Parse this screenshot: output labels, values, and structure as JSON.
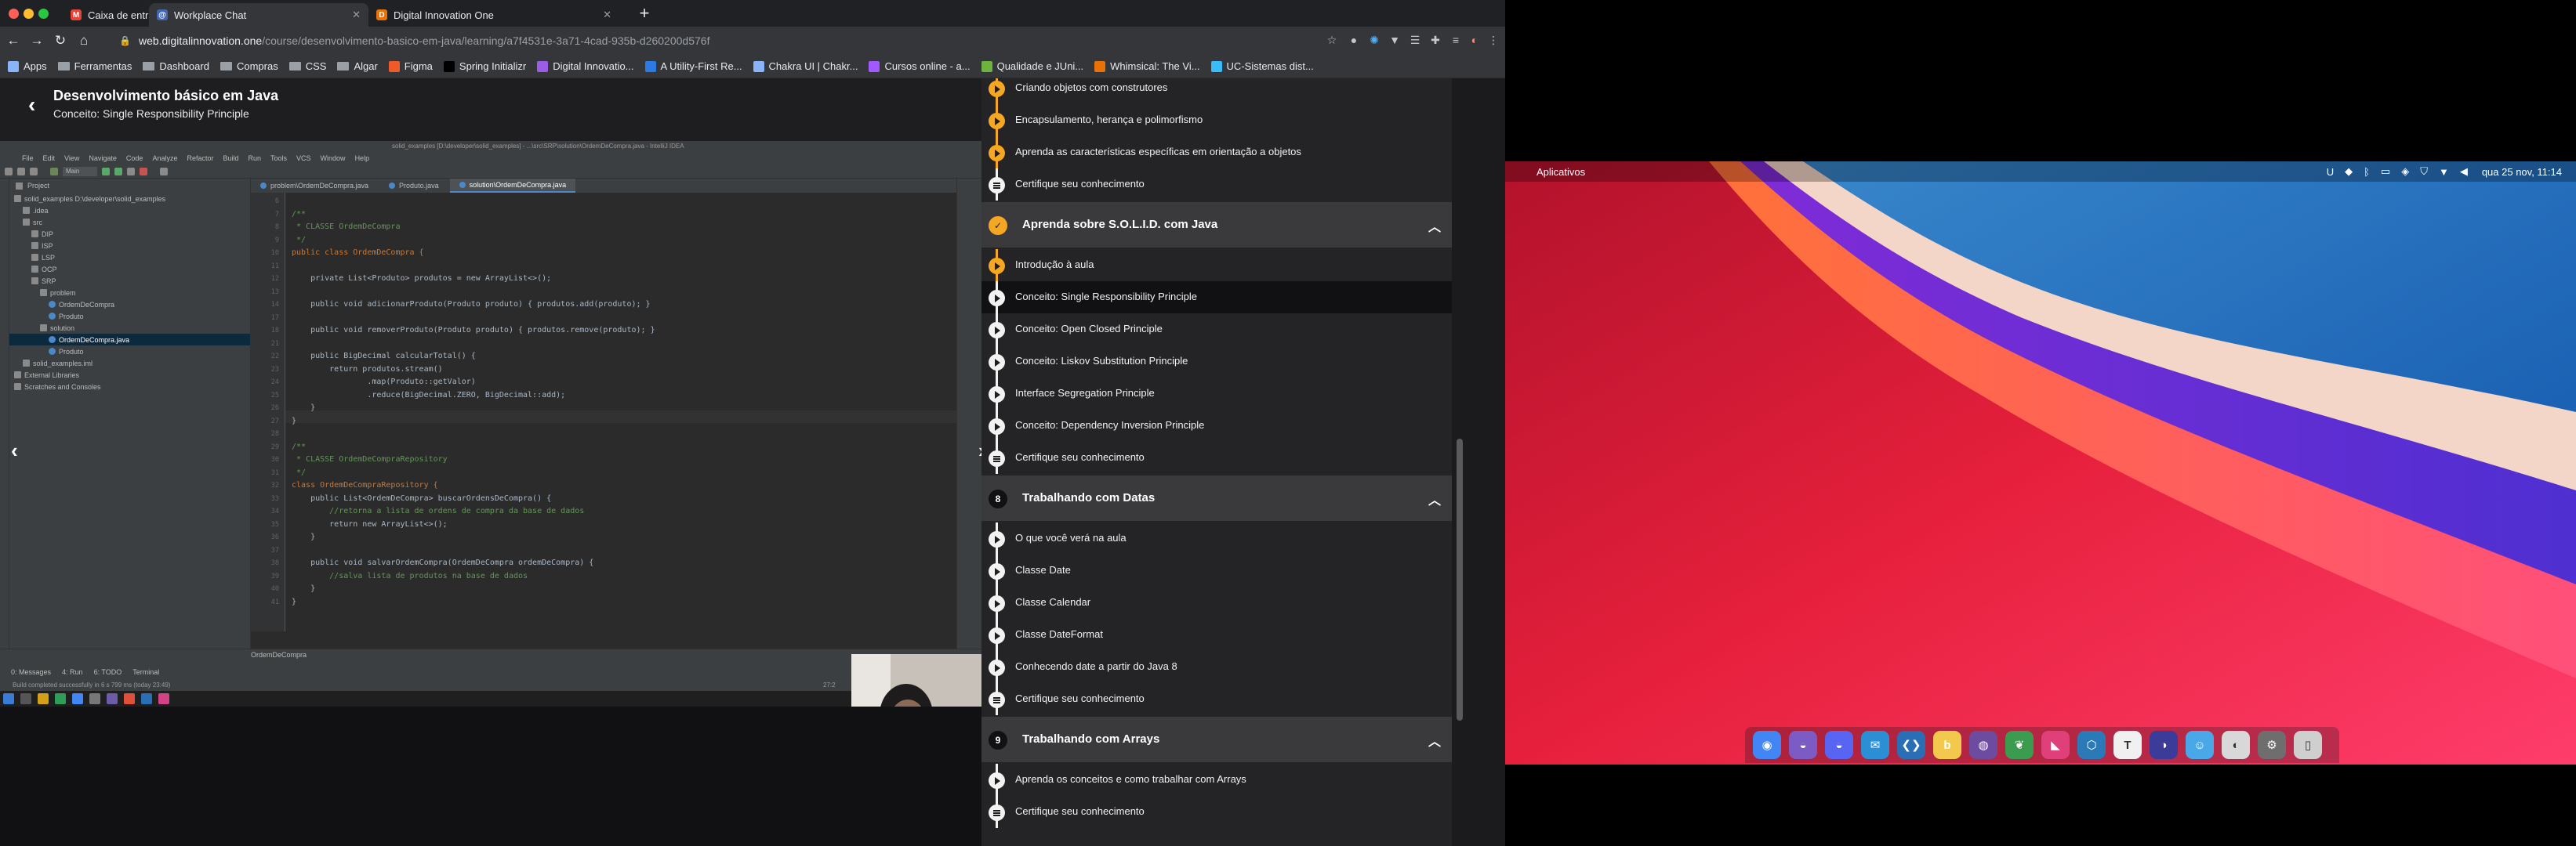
{
  "browser": {
    "tabs": [
      {
        "title": "Caixa de entrada - marcosvo",
        "active": false,
        "icon": "gmail-icon",
        "color": "#ea4335"
      },
      {
        "title": "Workplace Chat",
        "active": true,
        "icon": "workplace-chat-icon",
        "color": "#4267b2"
      },
      {
        "title": "Digital Innovation One",
        "active": false,
        "icon": "dio-icon",
        "color": "#e8710a"
      }
    ],
    "address": {
      "host": "web.digitalinnovation.one",
      "path": "/course/desenvolvimento-basico-em-java/learning/a7f4531e-3a71-4cad-935b-d260200d576f"
    },
    "bookmarks": [
      {
        "label": "Apps",
        "type": "apps-icon"
      },
      {
        "label": "Ferramentas",
        "type": "folder"
      },
      {
        "label": "Dashboard",
        "type": "folder"
      },
      {
        "label": "Compras",
        "type": "folder"
      },
      {
        "label": "CSS",
        "type": "folder"
      },
      {
        "label": "Algar",
        "type": "folder"
      },
      {
        "label": "Figma",
        "type": "figma-icon"
      },
      {
        "label": "Spring Initializr",
        "type": "spring-icon"
      },
      {
        "label": "Digital Innovatio...",
        "type": "dio-icon"
      },
      {
        "label": "A Utility-First Re...",
        "type": "tailwind-icon"
      },
      {
        "label": "Chakra UI | Chakr...",
        "type": "chakra-icon"
      },
      {
        "label": "Cursos online - a...",
        "type": "alura-icon"
      },
      {
        "label": "Qualidade e JUni...",
        "type": "medium-icon"
      },
      {
        "label": "Whimsical: The Vi...",
        "type": "whimsical-icon"
      },
      {
        "label": "UC-Sistemas dist...",
        "type": "uc-icon"
      }
    ]
  },
  "course": {
    "title": "Desenvolvimento básico em Java",
    "subtitle": "Conceito: Single Responsibility Principle"
  },
  "ide": {
    "title": "solid_examples [D:\\developer\\solid_examples] - ...\\src\\SRP\\solution\\OrdemDeCompra.java - IntelliJ IDEA",
    "menu": [
      "File",
      "Edit",
      "View",
      "Navigate",
      "Code",
      "Analyze",
      "Refactor",
      "Build",
      "Run",
      "Tools",
      "VCS",
      "Window",
      "Help"
    ],
    "run_config": "Main",
    "project_header": "Project",
    "tree": [
      {
        "label": "solid_examples D:\\developer\\solid_examples",
        "indent": 0,
        "type": "module",
        "selected": false
      },
      {
        "label": ".idea",
        "indent": 1,
        "type": "folder",
        "selected": false
      },
      {
        "label": "src",
        "indent": 1,
        "type": "folder",
        "selected": false
      },
      {
        "label": "DIP",
        "indent": 2,
        "type": "package",
        "selected": false
      },
      {
        "label": "ISP",
        "indent": 2,
        "type": "package",
        "selected": false
      },
      {
        "label": "LSP",
        "indent": 2,
        "type": "package",
        "selected": false
      },
      {
        "label": "OCP",
        "indent": 2,
        "type": "package",
        "selected": false
      },
      {
        "label": "SRP",
        "indent": 2,
        "type": "package",
        "selected": false
      },
      {
        "label": "problem",
        "indent": 3,
        "type": "package",
        "selected": false
      },
      {
        "label": "OrdemDeCompra",
        "indent": 4,
        "type": "class",
        "selected": false
      },
      {
        "label": "Produto",
        "indent": 4,
        "type": "class",
        "selected": false
      },
      {
        "label": "solution",
        "indent": 3,
        "type": "package",
        "selected": false
      },
      {
        "label": "OrdemDeCompra.java",
        "indent": 4,
        "type": "class",
        "selected": true
      },
      {
        "label": "Produto",
        "indent": 4,
        "type": "class",
        "selected": false
      },
      {
        "label": "solid_examples.iml",
        "indent": 1,
        "type": "file",
        "selected": false
      },
      {
        "label": "External Libraries",
        "indent": 0,
        "type": "library",
        "selected": false
      },
      {
        "label": "Scratches and Consoles",
        "indent": 0,
        "type": "scratch",
        "selected": false
      }
    ],
    "editor_tabs": [
      {
        "label": "problem\\OrdemDeCompra.java",
        "active": false
      },
      {
        "label": "Produto.java",
        "active": false
      },
      {
        "label": "solution\\OrdemDeCompra.java",
        "active": true
      }
    ],
    "code_lines": [
      {
        "n": "6",
        "text": ""
      },
      {
        "n": "7",
        "text": "/**",
        "cls": "cm"
      },
      {
        "n": "8",
        "text": " * CLASSE OrdemDeCompra",
        "cls": "cm"
      },
      {
        "n": "9",
        "text": " */",
        "cls": "cm"
      },
      {
        "n": "10",
        "text": "public class OrdemDeCompra {",
        "cls": "kw"
      },
      {
        "n": "11",
        "text": ""
      },
      {
        "n": "12",
        "text": "    private List<Produto> produtos = new ArrayList<>();"
      },
      {
        "n": "13",
        "text": ""
      },
      {
        "n": "14",
        "text": "    public void adicionarProduto(Produto produto) { produtos.add(produto); }"
      },
      {
        "n": "17",
        "text": ""
      },
      {
        "n": "18",
        "text": "    public void removerProduto(Produto produto) { produtos.remove(produto); }"
      },
      {
        "n": "21",
        "text": ""
      },
      {
        "n": "22",
        "text": "    public BigDecimal calcularTotal() {"
      },
      {
        "n": "23",
        "text": "        return produtos.stream()"
      },
      {
        "n": "24",
        "text": "                .map(Produto::getValor)"
      },
      {
        "n": "25",
        "text": "                .reduce(BigDecimal.ZERO, BigDecimal::add);"
      },
      {
        "n": "26",
        "text": "    }"
      },
      {
        "n": "27",
        "text": "}"
      },
      {
        "n": "28",
        "text": ""
      },
      {
        "n": "29",
        "text": "/**",
        "cls": "cm"
      },
      {
        "n": "30",
        "text": " * CLASSE OrdemDeCompraRepository",
        "cls": "cm"
      },
      {
        "n": "31",
        "text": " */",
        "cls": "cm"
      },
      {
        "n": "32",
        "text": "class OrdemDeCompraRepository {",
        "cls": "kw"
      },
      {
        "n": "33",
        "text": "    public List<OrdemDeCompra> buscarOrdensDeCompra() {"
      },
      {
        "n": "34",
        "text": "        //retorna a lista de ordens de compra da base de dados",
        "cls": "cm"
      },
      {
        "n": "35",
        "text": "        return new ArrayList<>();"
      },
      {
        "n": "36",
        "text": "    }"
      },
      {
        "n": "37",
        "text": ""
      },
      {
        "n": "38",
        "text": "    public void salvarOrdemCompra(OrdemDeCompra ordemDeCompra) {"
      },
      {
        "n": "39",
        "text": "        //salva lista de produtos na base de dados",
        "cls": "cm"
      },
      {
        "n": "40",
        "text": "    }"
      },
      {
        "n": "41",
        "text": "}"
      }
    ],
    "breadcrumb": "OrdemDeCompra",
    "bottom_tabs": [
      "0: Messages",
      "4: Run",
      "6: TODO",
      "Terminal"
    ],
    "status": "Build completed successfully in 6 s 799 ms (today 23:49)",
    "cursor_pos": "27:2"
  },
  "sidebar": {
    "items_top": [
      {
        "label": "Criando objetos com construtores",
        "icon": "play",
        "color": "orange"
      },
      {
        "label": "Encapsulamento, herança e polimorfismo",
        "icon": "play",
        "color": "orange"
      },
      {
        "label": "Aprenda as características específicas em orientação a objetos",
        "icon": "play",
        "color": "orange"
      },
      {
        "label": "Certifique seu conhecimento",
        "icon": "quiz",
        "color": "white"
      }
    ],
    "sections": [
      {
        "number": "✓",
        "title": "Aprenda sobre S.O.L.I.D. com Java",
        "done": true,
        "items": [
          {
            "label": "Introdução à aula",
            "icon": "play",
            "color": "orange",
            "current": false
          },
          {
            "label": "Conceito: Single Responsibility Principle",
            "icon": "play",
            "color": "white",
            "current": true
          },
          {
            "label": "Conceito: Open Closed Principle",
            "icon": "play",
            "color": "white",
            "current": false
          },
          {
            "label": "Conceito: Liskov Substitution Principle",
            "icon": "play",
            "color": "white",
            "current": false
          },
          {
            "label": "Interface Segregation Principle",
            "icon": "play",
            "color": "white",
            "current": false
          },
          {
            "label": "Conceito: Dependency Inversion Principle",
            "icon": "play",
            "color": "white",
            "current": false
          },
          {
            "label": "Certifique seu conhecimento",
            "icon": "quiz",
            "color": "white",
            "current": false
          }
        ]
      },
      {
        "number": "8",
        "title": "Trabalhando com Datas",
        "done": false,
        "items": [
          {
            "label": "O que você verá na aula",
            "icon": "play",
            "color": "white",
            "current": false
          },
          {
            "label": "Classe Date",
            "icon": "play",
            "color": "white",
            "current": false
          },
          {
            "label": "Classe Calendar",
            "icon": "play",
            "color": "white",
            "current": false
          },
          {
            "label": "Classe DateFormat",
            "icon": "play",
            "color": "white",
            "current": false
          },
          {
            "label": "Conhecendo date a partir do Java 8",
            "icon": "play",
            "color": "white",
            "current": false
          },
          {
            "label": "Certifique seu conhecimento",
            "icon": "quiz",
            "color": "white",
            "current": false
          }
        ]
      },
      {
        "number": "9",
        "title": "Trabalhando com Arrays",
        "done": false,
        "items": [
          {
            "label": "Aprenda os conceitos e como trabalhar com Arrays",
            "icon": "play",
            "color": "white",
            "current": false
          },
          {
            "label": "Certifique seu conhecimento",
            "icon": "quiz",
            "color": "white",
            "current": false
          }
        ]
      }
    ]
  },
  "desktop": {
    "menubar": {
      "apple": "",
      "apps": "Aplicativos",
      "clock": "qua 25 nov, 11:14"
    },
    "dock": [
      {
        "name": "chrome-icon",
        "color": "#4285f4"
      },
      {
        "name": "discord-ptb-icon",
        "color": "#7c5cc4"
      },
      {
        "name": "discord-icon",
        "color": "#5865f2"
      },
      {
        "name": "thunderbird-icon",
        "color": "#2b8fd6"
      },
      {
        "name": "vscode-icon",
        "color": "#2a6fb5"
      },
      {
        "name": "beekeeper-icon",
        "color": "#f2c94c"
      },
      {
        "name": "insomnia-icon",
        "color": "#6d4c9f"
      },
      {
        "name": "mongodb-compass-icon",
        "color": "#3b9b4f"
      },
      {
        "name": "jetbrains-icon",
        "color": "#e0407a"
      },
      {
        "name": "virtualbox-icon",
        "color": "#2a7ab8"
      },
      {
        "name": "typora-icon",
        "color": "#f0f0f0"
      },
      {
        "name": "eclipse-icon",
        "color": "#3b3b9a"
      },
      {
        "name": "finder-icon",
        "color": "#4aa8e8"
      },
      {
        "name": "disk-icon",
        "color": "#d8d8d8"
      },
      {
        "name": "settings-icon",
        "color": "#6e6e6e"
      },
      {
        "name": "trash-icon",
        "color": "#cfcfcf"
      }
    ]
  }
}
